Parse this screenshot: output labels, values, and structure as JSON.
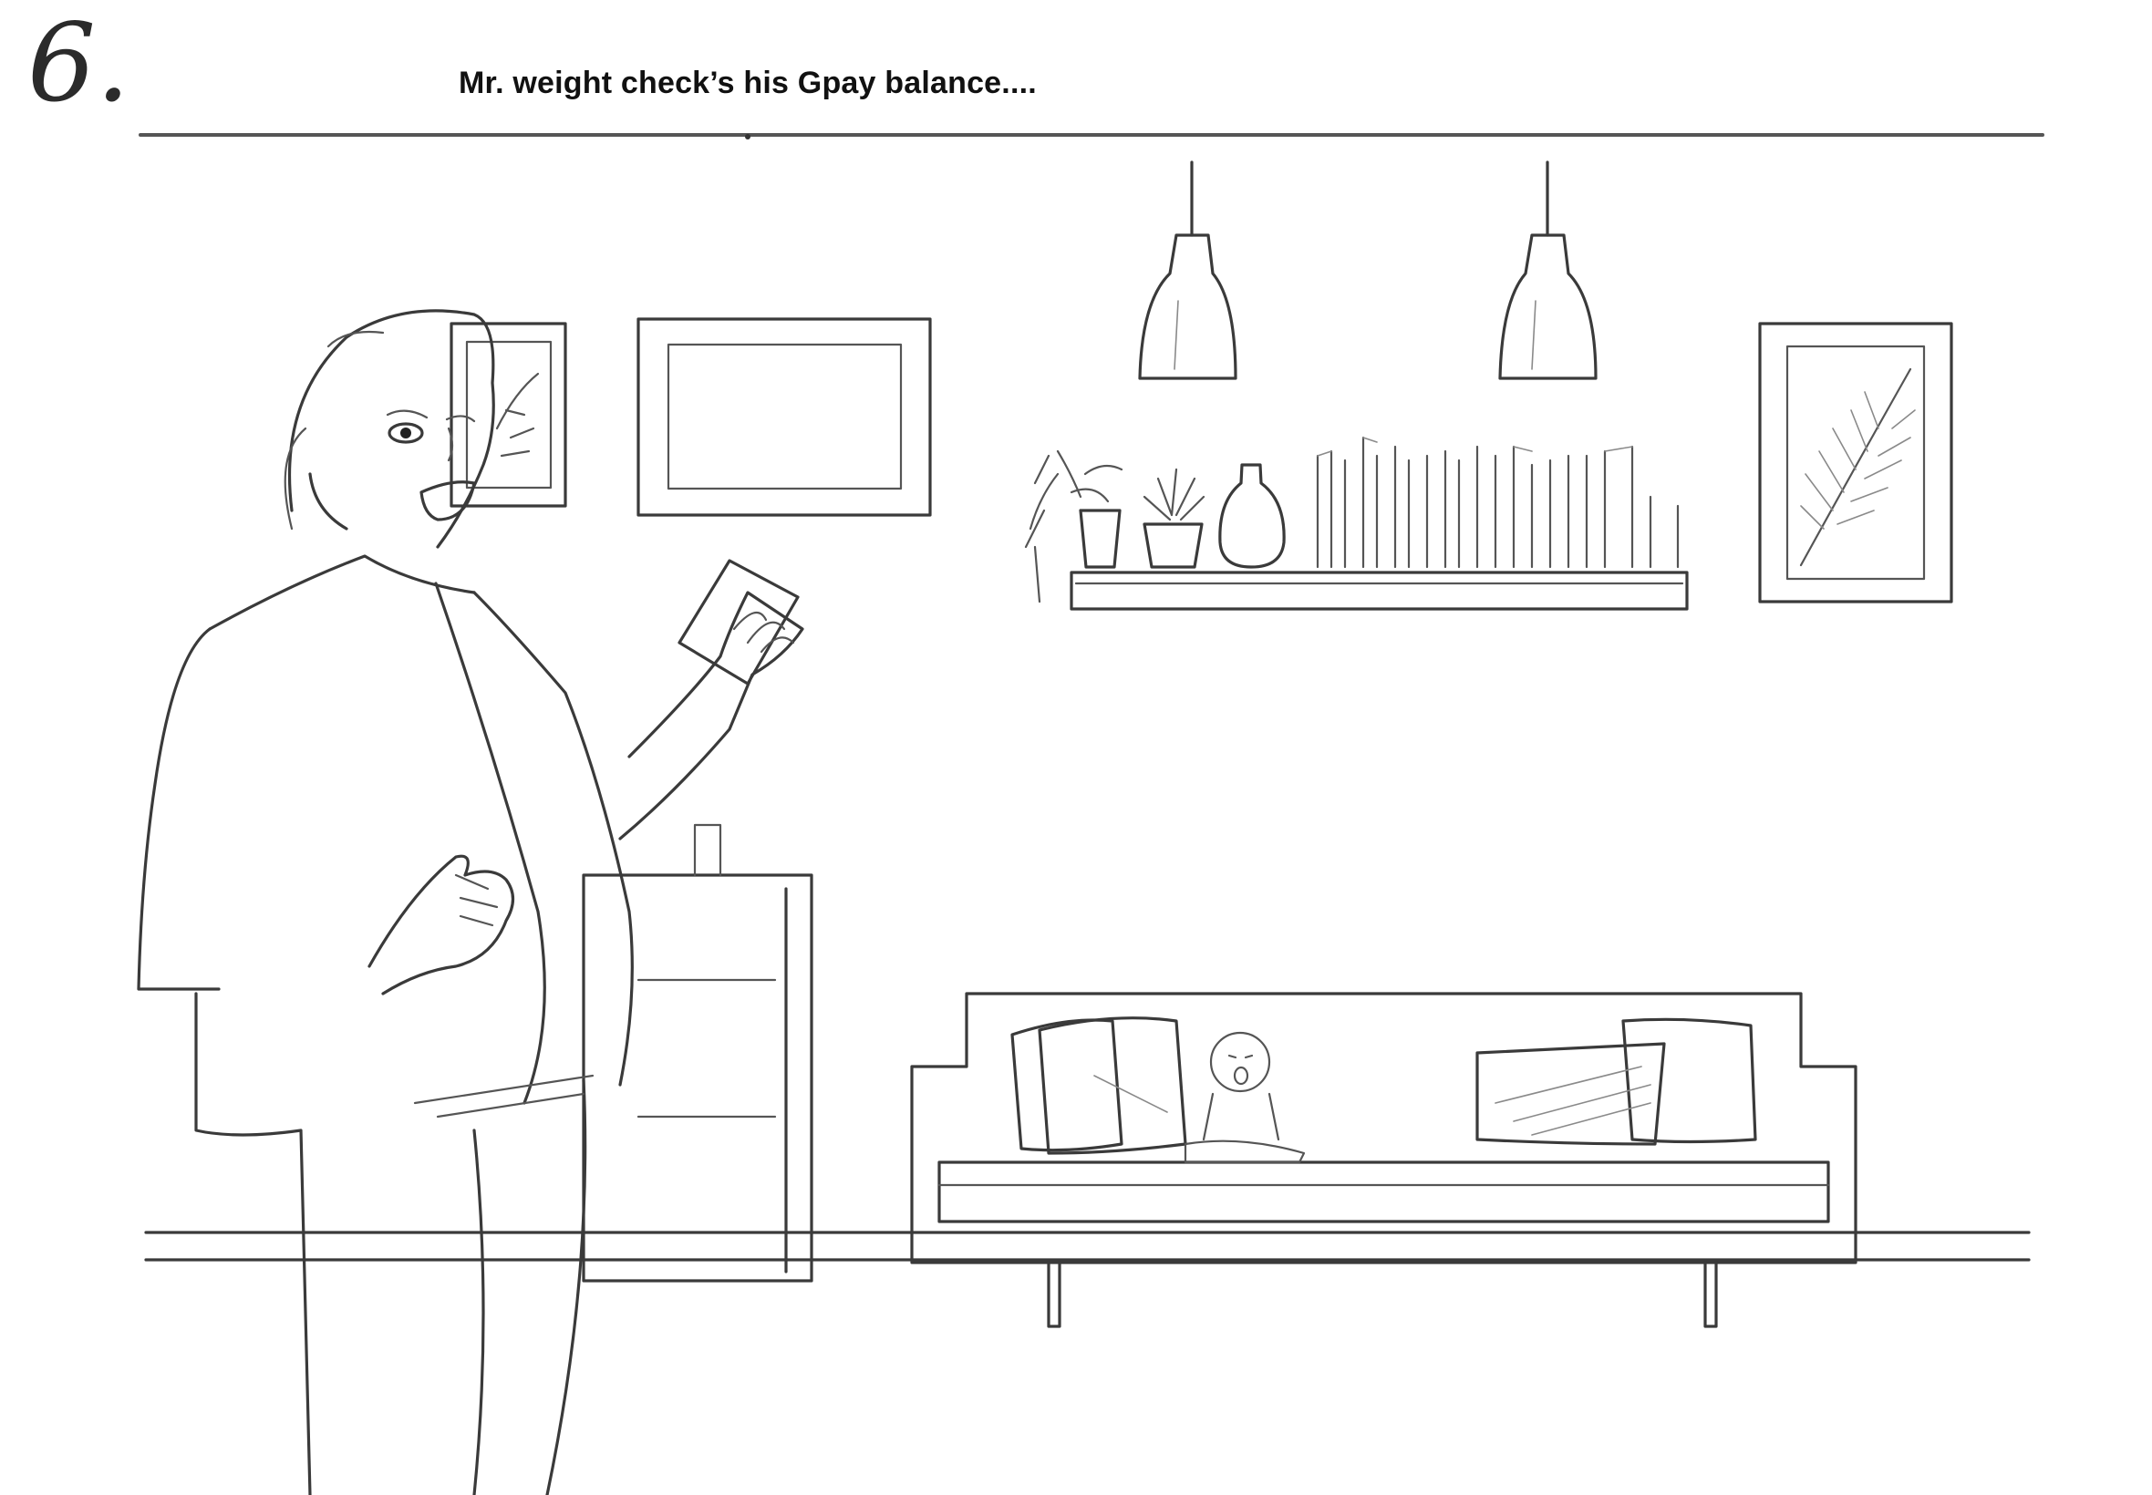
{
  "panel": {
    "number": "6.",
    "caption": "Mr. weight check’s his Gpay balance...."
  },
  "colors": {
    "ink": "#3a3a3a",
    "paper": "#ffffff",
    "caption_text": "#111111"
  }
}
